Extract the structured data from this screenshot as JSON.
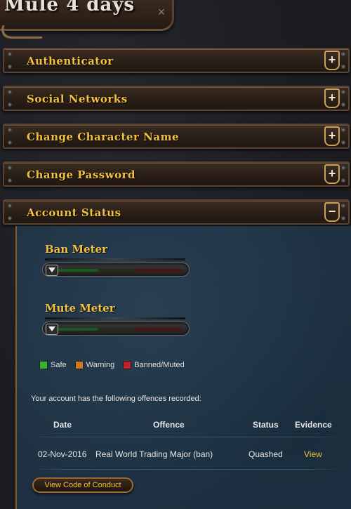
{
  "header": {
    "title": "Mule 4 days"
  },
  "sections": [
    {
      "label": "Authenticator",
      "toggle": "+"
    },
    {
      "label": "Social Networks",
      "toggle": "+"
    },
    {
      "label": "Change Character Name",
      "toggle": "+"
    },
    {
      "label": "Change Password",
      "toggle": "+"
    },
    {
      "label": "Account Status",
      "toggle": "−"
    }
  ],
  "account_status": {
    "ban_meter": {
      "title": "Ban Meter",
      "level": 0
    },
    "mute_meter": {
      "title": "Mute Meter",
      "level": 0
    },
    "legend": [
      {
        "label": "Safe",
        "color": "#2fb82f"
      },
      {
        "label": "Warning",
        "color": "#d07a20"
      },
      {
        "label": "Banned/Muted",
        "color": "#c0202a"
      }
    ],
    "offences_intro": "Your account has the following offences recorded:",
    "columns": {
      "date": "Date",
      "offence": "Offence",
      "status": "Status",
      "evidence": "Evidence"
    },
    "offences": [
      {
        "date": "02-Nov-2016",
        "offence": "Real World Trading Major (ban)",
        "status": "Quashed",
        "evidence": "View"
      }
    ],
    "conduct_button": "View Code of Conduct"
  }
}
